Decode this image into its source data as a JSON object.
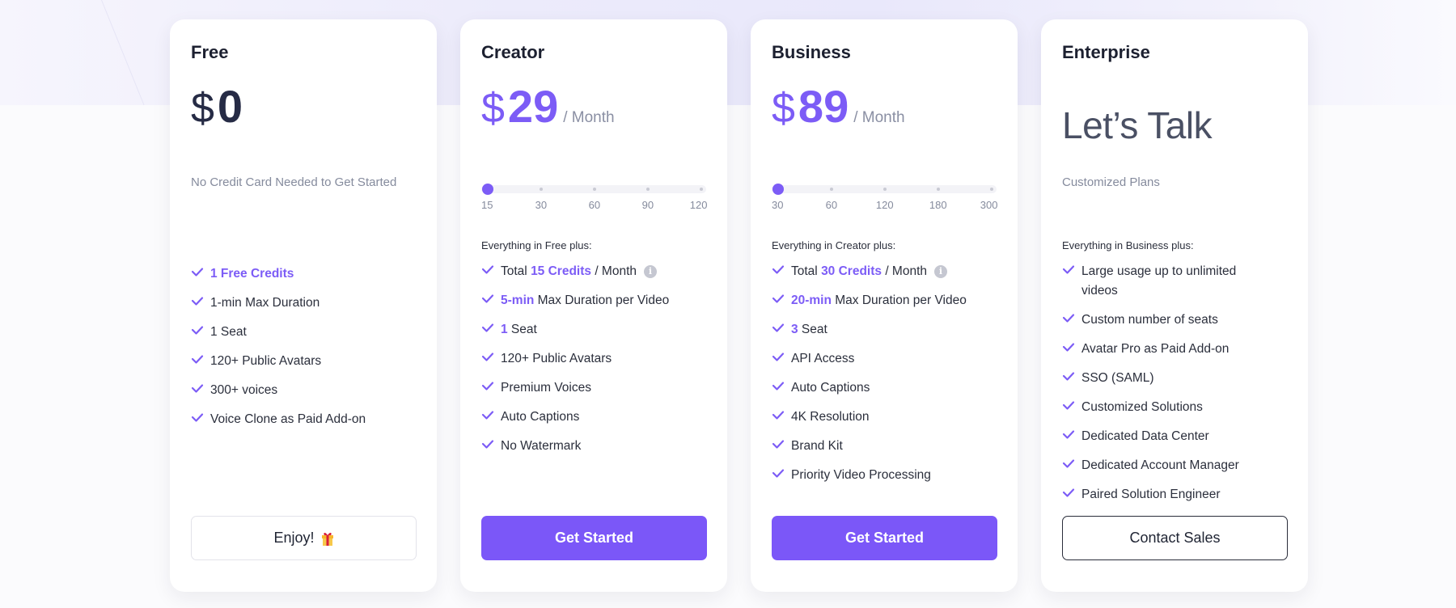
{
  "theme": {
    "accent": "#7c5cf6",
    "button_primary": "#7b57f8",
    "text_dark": "#1f2433",
    "muted": "#858b9d"
  },
  "plans": [
    {
      "name": "Free",
      "currency": "$",
      "price": "0",
      "period": "",
      "subtitle": "No Credit Card Needed to Get Started",
      "features": [
        {
          "parts": [
            {
              "text": "1 Free Credits",
              "hl": true
            }
          ]
        },
        {
          "parts": [
            {
              "text": "1-min Max Duration",
              "hl": false
            }
          ]
        },
        {
          "parts": [
            {
              "text": "1 Seat",
              "hl": false
            }
          ]
        },
        {
          "parts": [
            {
              "text": "120+ Public Avatars",
              "hl": false
            }
          ]
        },
        {
          "parts": [
            {
              "text": "300+ voices",
              "hl": false
            }
          ]
        },
        {
          "parts": [
            {
              "text": "Voice Clone as Paid Add-on",
              "hl": false
            }
          ]
        }
      ],
      "button": {
        "label": "Enjoy!",
        "icon": "gift-icon",
        "style": "ghost"
      }
    },
    {
      "name": "Creator",
      "currency": "$",
      "price": "29",
      "period": "/ Month",
      "slider": {
        "ticks": [
          "15",
          "30",
          "60",
          "90",
          "120"
        ],
        "selected_index": 0
      },
      "section_label": "Everything in Free plus:",
      "features": [
        {
          "parts": [
            {
              "text": "Total ",
              "hl": false
            },
            {
              "text": "15 Credits",
              "hl": true
            },
            {
              "text": " / Month",
              "hl": false
            }
          ],
          "info": true
        },
        {
          "parts": [
            {
              "text": "5-min",
              "hl": true
            },
            {
              "text": " Max Duration per Video",
              "hl": false
            }
          ]
        },
        {
          "parts": [
            {
              "text": "1",
              "hl": true
            },
            {
              "text": " Seat",
              "hl": false
            }
          ]
        },
        {
          "parts": [
            {
              "text": "120+ Public Avatars",
              "hl": false
            }
          ]
        },
        {
          "parts": [
            {
              "text": "Premium Voices",
              "hl": false
            }
          ]
        },
        {
          "parts": [
            {
              "text": "Auto Captions",
              "hl": false
            }
          ]
        },
        {
          "parts": [
            {
              "text": "No Watermark",
              "hl": false
            }
          ]
        }
      ],
      "button": {
        "label": "Get Started",
        "style": "primary"
      }
    },
    {
      "name": "Business",
      "currency": "$",
      "price": "89",
      "period": "/ Month",
      "slider": {
        "ticks": [
          "30",
          "60",
          "120",
          "180",
          "300"
        ],
        "selected_index": 0
      },
      "section_label": "Everything in Creator plus:",
      "features": [
        {
          "parts": [
            {
              "text": "Total ",
              "hl": false
            },
            {
              "text": "30 Credits",
              "hl": true
            },
            {
              "text": " / Month",
              "hl": false
            }
          ],
          "info": true
        },
        {
          "parts": [
            {
              "text": "20-min",
              "hl": true
            },
            {
              "text": " Max Duration per Video",
              "hl": false
            }
          ]
        },
        {
          "parts": [
            {
              "text": "3",
              "hl": true
            },
            {
              "text": " Seat",
              "hl": false
            }
          ]
        },
        {
          "parts": [
            {
              "text": "API Access",
              "hl": false
            }
          ]
        },
        {
          "parts": [
            {
              "text": "Auto Captions",
              "hl": false
            }
          ]
        },
        {
          "parts": [
            {
              "text": "4K Resolution",
              "hl": false
            }
          ]
        },
        {
          "parts": [
            {
              "text": "Brand Kit",
              "hl": false
            }
          ]
        },
        {
          "parts": [
            {
              "text": "Priority Video Processing",
              "hl": false
            }
          ]
        }
      ],
      "button": {
        "label": "Get Started",
        "style": "primary"
      }
    },
    {
      "name": "Enterprise",
      "headline": "Let’s Talk",
      "subtitle": "Customized Plans",
      "section_label": "Everything in Business plus:",
      "features": [
        {
          "parts": [
            {
              "text": "Large usage up to unlimited videos",
              "hl": false
            }
          ]
        },
        {
          "parts": [
            {
              "text": "Custom number of seats",
              "hl": false
            }
          ]
        },
        {
          "parts": [
            {
              "text": "Avatar Pro as Paid Add-on",
              "hl": false
            }
          ]
        },
        {
          "parts": [
            {
              "text": "SSO (SAML)",
              "hl": false
            }
          ]
        },
        {
          "parts": [
            {
              "text": "Customized Solutions",
              "hl": false
            }
          ]
        },
        {
          "parts": [
            {
              "text": "Dedicated Data Center",
              "hl": false
            }
          ]
        },
        {
          "parts": [
            {
              "text": "Dedicated Account Manager",
              "hl": false
            }
          ]
        },
        {
          "parts": [
            {
              "text": "Paired Solution Engineer",
              "hl": false
            }
          ]
        }
      ],
      "button": {
        "label": "Contact Sales",
        "style": "outline"
      }
    }
  ]
}
